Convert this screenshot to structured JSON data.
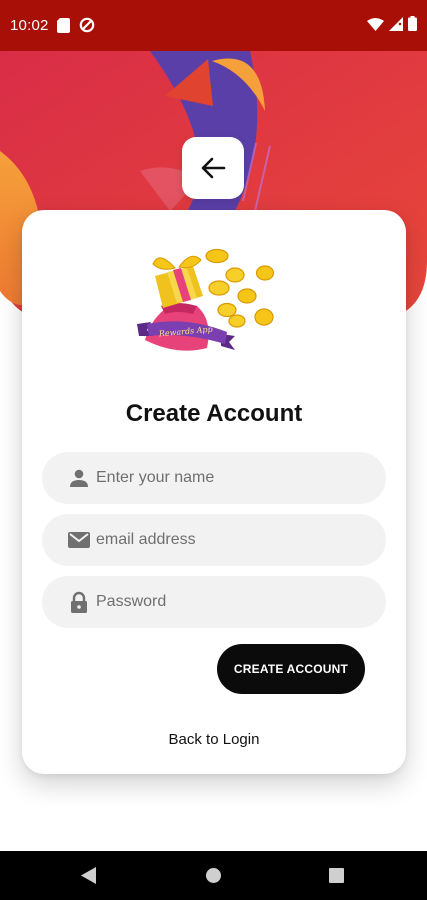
{
  "status_bar": {
    "time": "10:02",
    "left_icons": [
      "sd-card-icon",
      "data-saver-icon"
    ],
    "right_icons": [
      "wifi-icon",
      "cellular-signal-icon",
      "battery-icon"
    ]
  },
  "colors": {
    "status_bar": "#a80f06",
    "hero_gradient_start": "#d92d47",
    "hero_gradient_end": "#e8473a",
    "accent_orange": "#f5a03a",
    "accent_purple": "#5b3fa8",
    "button_dark": "#0b0b0b",
    "field_bg": "#f2f2f2"
  },
  "header": {
    "back_icon": "arrow-left-icon"
  },
  "logo": {
    "label": "Rewards App",
    "icon": "gift-coins-logo"
  },
  "form": {
    "title": "Create Account",
    "fields": [
      {
        "icon": "person-icon",
        "placeholder": "Enter your name",
        "value": ""
      },
      {
        "icon": "mail-icon",
        "placeholder": "email address",
        "value": ""
      },
      {
        "icon": "lock-icon",
        "placeholder": "Password",
        "value": ""
      }
    ],
    "submit_label": "CREATE ACCOUNT",
    "back_to_login": "Back to Login"
  },
  "nav_bar": {
    "icons": [
      "nav-back-icon",
      "nav-home-icon",
      "nav-recents-icon"
    ]
  }
}
